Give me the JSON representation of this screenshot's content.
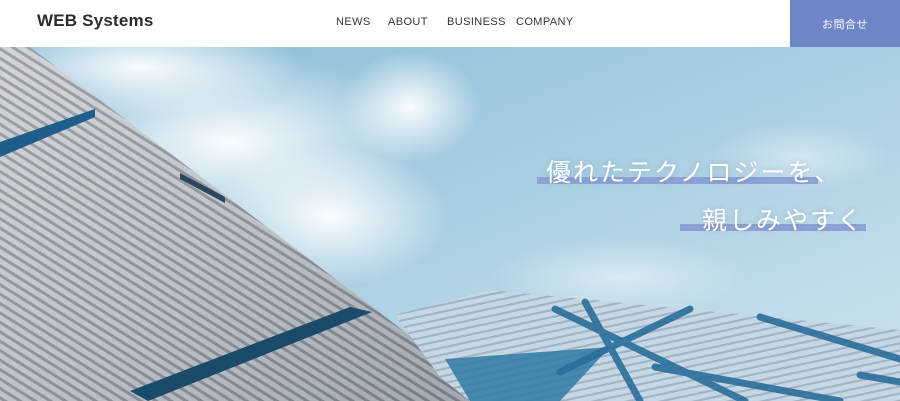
{
  "header": {
    "logo": "WEB Systems",
    "nav": [
      "NEWS",
      "ABOUT",
      "BUSINESS",
      "COMPANY"
    ],
    "contact_label": "お問合せ"
  },
  "hero": {
    "tagline_line1": "優れたテクノロジーを、",
    "tagline_line2": "親しみやすく",
    "image": "glass-building-sky"
  },
  "colors": {
    "accent": "#6f86c6",
    "underline": "#8a9dd3",
    "sky": "#a9cfe2"
  }
}
